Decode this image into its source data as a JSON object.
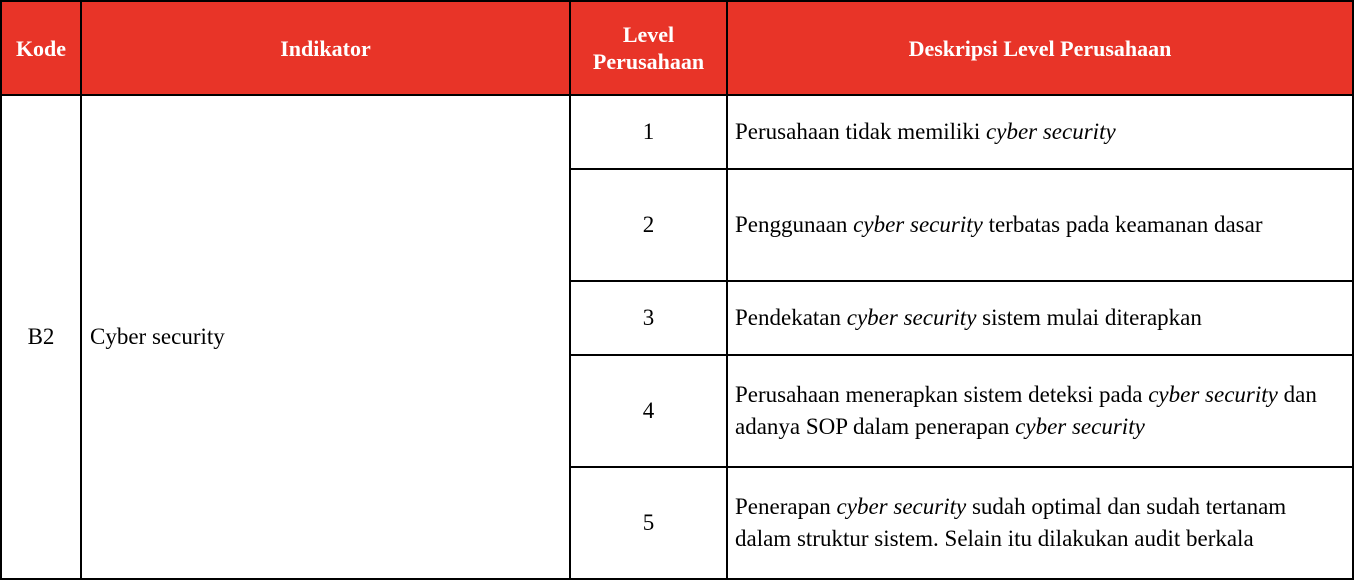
{
  "header": {
    "kode": "Kode",
    "indikator": "Indikator",
    "level_line1": "Level",
    "level_line2": "Perusahaan",
    "deskripsi": "Deskripsi Level Perusahaan"
  },
  "row": {
    "kode": "B2",
    "indikator": "Cyber security"
  },
  "levels": [
    {
      "level": "1",
      "desc": [
        {
          "t": "Perusahaan tidak memiliki ",
          "i": false
        },
        {
          "t": "cyber security",
          "i": true
        }
      ]
    },
    {
      "level": "2",
      "desc": [
        {
          "t": "Penggunaan ",
          "i": false
        },
        {
          "t": "cyber security",
          "i": true
        },
        {
          "t": " terbatas pada keamanan dasar",
          "i": false
        }
      ]
    },
    {
      "level": "3",
      "desc": [
        {
          "t": "Pendekatan ",
          "i": false
        },
        {
          "t": "cyber security",
          "i": true
        },
        {
          "t": " sistem mulai diterapkan",
          "i": false
        }
      ]
    },
    {
      "level": "4",
      "desc": [
        {
          "t": "Perusahaan menerapkan sistem deteksi pada ",
          "i": false
        },
        {
          "t": "cyber security",
          "i": true
        },
        {
          "t": " dan adanya SOP dalam penerapan ",
          "i": false
        },
        {
          "t": "cyber security",
          "i": true
        }
      ]
    },
    {
      "level": "5",
      "desc": [
        {
          "t": "Penerapan ",
          "i": false
        },
        {
          "t": "cyber security",
          "i": true
        },
        {
          "t": " sudah optimal dan sudah tertanam dalam struktur sistem. Selain itu dilakukan audit berkala",
          "i": false
        }
      ]
    }
  ]
}
